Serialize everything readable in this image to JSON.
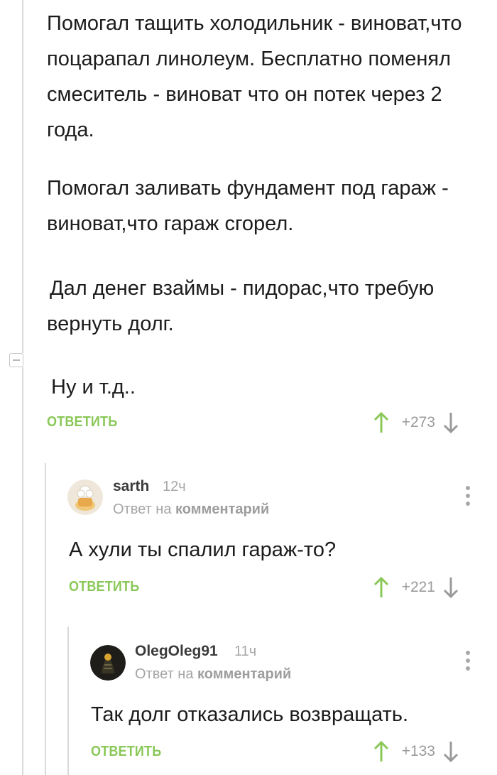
{
  "comment_main": {
    "paragraphs": [
      "Помогал тащить холодильник - виноват,что поцарапал линолеум. Бесплатно поменял смеситель - виноват что он потек через 2 года.",
      "Помогал заливать фундамент под гараж - виноват,что гараж сгорел.",
      "Дал денег взаймы - пидорас,что требую вернуть долг.",
      "Ну и т.д.."
    ],
    "reply_label": "ОТВЕТИТЬ",
    "score": "+273"
  },
  "reply1": {
    "username": "sarth",
    "time": "12ч",
    "meta_prefix": "Ответ на",
    "meta_link": "комментарий",
    "text": "А хули ты спалил гараж-то?",
    "reply_label": "ОТВЕТИТЬ",
    "score": "+221"
  },
  "reply2": {
    "username": "OlegOleg91",
    "time": "11ч",
    "meta_prefix": "Ответ на",
    "meta_link": "комментарий",
    "text": "Так долг отказались возвращать.",
    "reply_label": "ОТВЕТИТЬ",
    "score": "+133"
  },
  "icons": {
    "upvote": "arrow-up-icon",
    "downvote": "arrow-down-icon",
    "more": "more-vertical-icon",
    "collapse": "collapse-minus-icon"
  },
  "colors": {
    "accent_green": "#8ac858",
    "muted": "#a8a8a8",
    "thread_line": "#d9d9d9"
  }
}
